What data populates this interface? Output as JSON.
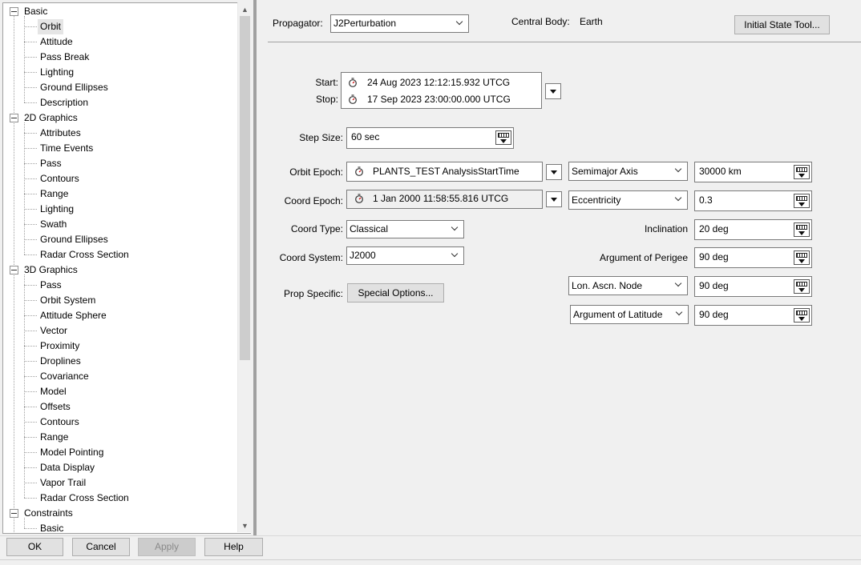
{
  "tree": {
    "categories": [
      {
        "label": "Basic",
        "children": [
          "Orbit",
          "Attitude",
          "Pass Break",
          "Lighting",
          "Ground Ellipses",
          "Description"
        ]
      },
      {
        "label": "2D Graphics",
        "children": [
          "Attributes",
          "Time Events",
          "Pass",
          "Contours",
          "Range",
          "Lighting",
          "Swath",
          "Ground Ellipses",
          "Radar Cross Section"
        ]
      },
      {
        "label": "3D Graphics",
        "children": [
          "Pass",
          "Orbit System",
          "Attitude Sphere",
          "Vector",
          "Proximity",
          "Droplines",
          "Covariance",
          "Model",
          "Offsets",
          "Contours",
          "Range",
          "Model Pointing",
          "Data Display",
          "Vapor Trail",
          "Radar Cross Section"
        ]
      },
      {
        "label": "Constraints",
        "children": [
          "Basic"
        ]
      }
    ],
    "selected": "Orbit"
  },
  "header": {
    "propagator_label": "Propagator:",
    "propagator_value": "J2Perturbation",
    "central_body_label": "Central Body:",
    "central_body_value": "Earth",
    "initial_state_button": "Initial State Tool..."
  },
  "interval": {
    "start_label": "Start:",
    "start_value": "24 Aug 2023 12:12:15.932 UTCG",
    "stop_label": "Stop:",
    "stop_value": "17 Sep 2023 23:00:00.000 UTCG"
  },
  "step": {
    "label": "Step Size:",
    "value": "60 sec"
  },
  "left_fields": {
    "orbit_epoch_label": "Orbit Epoch:",
    "orbit_epoch_value": "PLANTS_TEST AnalysisStartTime",
    "coord_epoch_label": "Coord Epoch:",
    "coord_epoch_value": "1 Jan 2000 11:58:55.816 UTCG",
    "coord_type_label": "Coord Type:",
    "coord_type_value": "Classical",
    "coord_system_label": "Coord System:",
    "coord_system_value": "J2000",
    "prop_specific_label": "Prop Specific:",
    "special_options_button": "Special Options..."
  },
  "elements": {
    "semimajor_label": "Semimajor Axis",
    "semimajor_value": "30000 km",
    "eccentricity_label": "Eccentricity",
    "eccentricity_value": "0.3",
    "inclination_label": "Inclination",
    "inclination_value": "20 deg",
    "arg_perigee_label": "Argument of Perigee",
    "arg_perigee_value": "90 deg",
    "lon_ascn_label": "Lon. Ascn. Node",
    "lon_ascn_value": "90 deg",
    "arg_latitude_label": "Argument of Latitude",
    "arg_latitude_value": "90 deg"
  },
  "footer": {
    "ok": "OK",
    "cancel": "Cancel",
    "apply": "Apply",
    "help": "Help"
  }
}
